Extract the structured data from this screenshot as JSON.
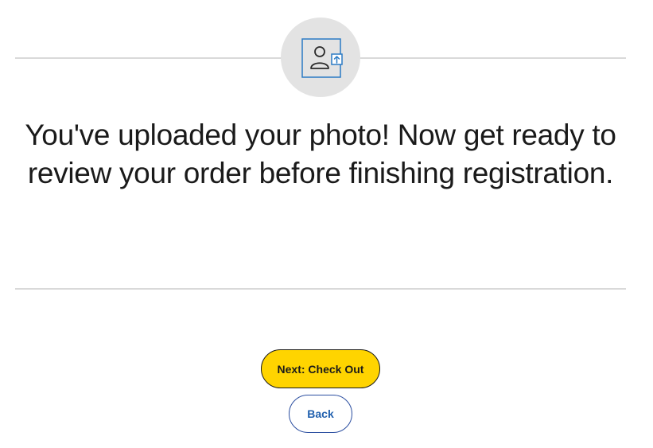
{
  "step_icon": "photo-upload-icon",
  "headline": "You've uploaded your photo! Now get ready to review your order before finishing registration.",
  "buttons": {
    "next_label": "Next: Check Out",
    "back_label": "Back"
  },
  "colors": {
    "next_button_bg": "#ffd400",
    "back_button_text": "#1f5fae",
    "icon_accent": "#2b7bc4",
    "icon_circle_bg": "#e3e3e3"
  }
}
